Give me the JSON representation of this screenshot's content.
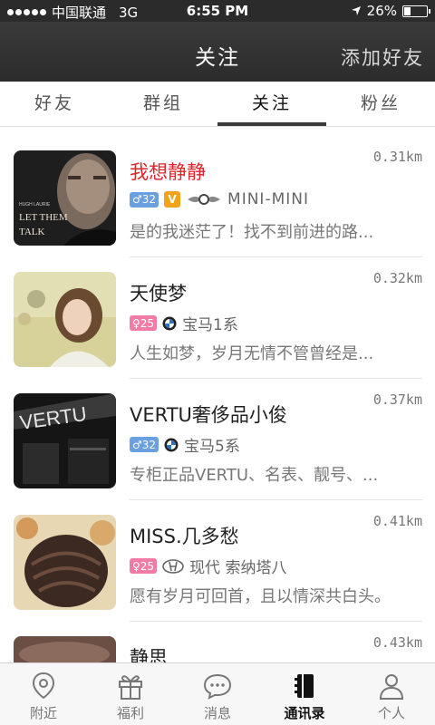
{
  "status_bar": {
    "carrier": "中国联通",
    "network": "3G",
    "time": "6:55 PM",
    "battery": "26%",
    "battery_level": 0.26
  },
  "nav": {
    "title": "关注",
    "add_friend": "添加好友"
  },
  "tabs": [
    {
      "label": "好友",
      "active": false
    },
    {
      "label": "群组",
      "active": false
    },
    {
      "label": "关注",
      "active": true
    },
    {
      "label": "粉丝",
      "active": false
    }
  ],
  "contacts": [
    {
      "name": "我想静静",
      "distance": "0.31km",
      "gender_age": "♂32",
      "vip": "V",
      "car": "MINI-MINI",
      "desc": "是的我迷茫了！找不到前进的路..."
    },
    {
      "name": "天使梦",
      "distance": "0.32km",
      "gender_age": "♀25",
      "car": "宝马1系",
      "desc": "人生如梦，岁月无情不管曾经是..."
    },
    {
      "name": "VERTU奢侈品小俊",
      "distance": "0.37km",
      "gender_age": "♂32",
      "car": "宝马5系",
      "desc": "专柜正品VERTU、名表、靓号、..."
    },
    {
      "name": "MISS.几多愁",
      "distance": "0.41km",
      "gender_age": "♀25",
      "car": "现代  索纳塔八",
      "desc": "愿有岁月可回首，且以情深共白头。"
    },
    {
      "name": "静思",
      "distance": "0.43km"
    }
  ],
  "avatar_text": {
    "top": "HUGH LAURIE",
    "main1": "LET THEM",
    "main2": "TALK"
  },
  "tabbar": [
    {
      "label": "附近",
      "icon": "location-pin-icon"
    },
    {
      "label": "福利",
      "icon": "gift-icon"
    },
    {
      "label": "消息",
      "icon": "chat-bubble-icon"
    },
    {
      "label": "通讯录",
      "icon": "contacts-book-icon",
      "active": true
    },
    {
      "label": "个人",
      "icon": "person-icon"
    }
  ]
}
